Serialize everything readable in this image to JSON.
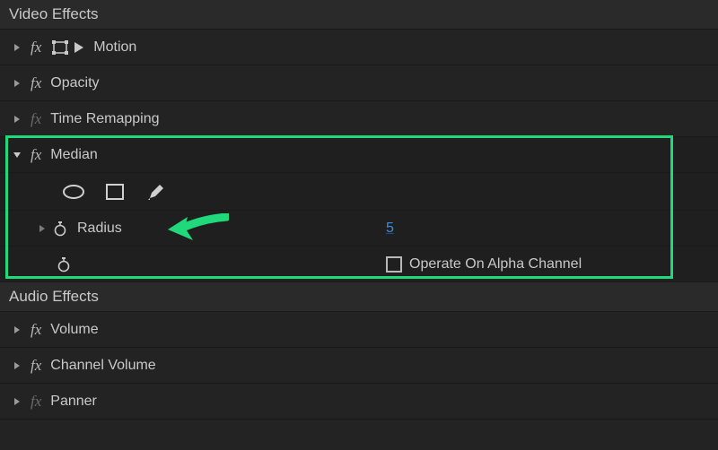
{
  "sections": {
    "video_effects": {
      "title": "Video Effects"
    },
    "audio_effects": {
      "title": "Audio Effects"
    }
  },
  "effects": {
    "motion": {
      "label": "Motion",
      "fx": "fx"
    },
    "opacity": {
      "label": "Opacity",
      "fx": "fx"
    },
    "time_remap": {
      "label": "Time Remapping",
      "fx": "fx"
    },
    "median": {
      "label": "Median",
      "fx": "fx"
    },
    "volume": {
      "label": "Volume",
      "fx": "fx"
    },
    "ch_volume": {
      "label": "Channel Volume",
      "fx": "fx"
    },
    "panner": {
      "label": "Panner",
      "fx": "fx"
    }
  },
  "median": {
    "radius_label": "Radius",
    "radius_value": "5",
    "alpha_label": "Operate On Alpha Channel",
    "alpha_checked": false
  },
  "annotation": {
    "highlight_color": "#20d97a",
    "arrow_target": "radius"
  }
}
